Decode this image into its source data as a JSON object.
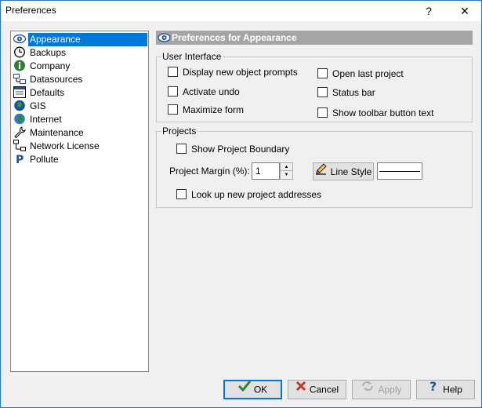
{
  "window": {
    "title": "Preferences",
    "help_glyph": "?",
    "close_glyph": "✕"
  },
  "sidebar": {
    "items": [
      {
        "label": "Appearance",
        "icon": "eye-icon",
        "selected": true
      },
      {
        "label": "Backups",
        "icon": "clock-icon"
      },
      {
        "label": "Company",
        "icon": "info-icon"
      },
      {
        "label": "Datasources",
        "icon": "datasources-icon"
      },
      {
        "label": "Defaults",
        "icon": "window-icon"
      },
      {
        "label": "GIS",
        "icon": "globe-icon"
      },
      {
        "label": "Internet",
        "icon": "internet-globe-icon"
      },
      {
        "label": "Maintenance",
        "icon": "wrench-icon"
      },
      {
        "label": "Network License",
        "icon": "network-icon"
      },
      {
        "label": "Pollute",
        "icon": "pollute-p-icon"
      }
    ]
  },
  "header": {
    "title": "Preferences for Appearance",
    "icon": "eye-icon"
  },
  "user_interface": {
    "legend": "User Interface",
    "display_new_object_prompts": "Display new object prompts",
    "activate_undo": "Activate undo",
    "maximize_form": "Maximize form",
    "open_last_project": "Open last project",
    "status_bar": "Status bar",
    "show_toolbar_button_text": "Show toolbar button text"
  },
  "projects": {
    "legend": "Projects",
    "show_project_boundary": "Show Project Boundary",
    "project_margin_label": "Project Margin (%):",
    "project_margin_value": "1",
    "line_style_label": "Line Style",
    "look_up_addresses": "Look up new project addresses"
  },
  "buttons": {
    "ok": "OK",
    "cancel": "Cancel",
    "apply": "Apply",
    "help": "Help"
  },
  "colors": {
    "selection": "#0078d7",
    "header_bar": "#a5a5a5",
    "ok_check": "#2a8a2a",
    "cancel_x": "#c0392b",
    "help_icon": "#1e5aa8"
  }
}
